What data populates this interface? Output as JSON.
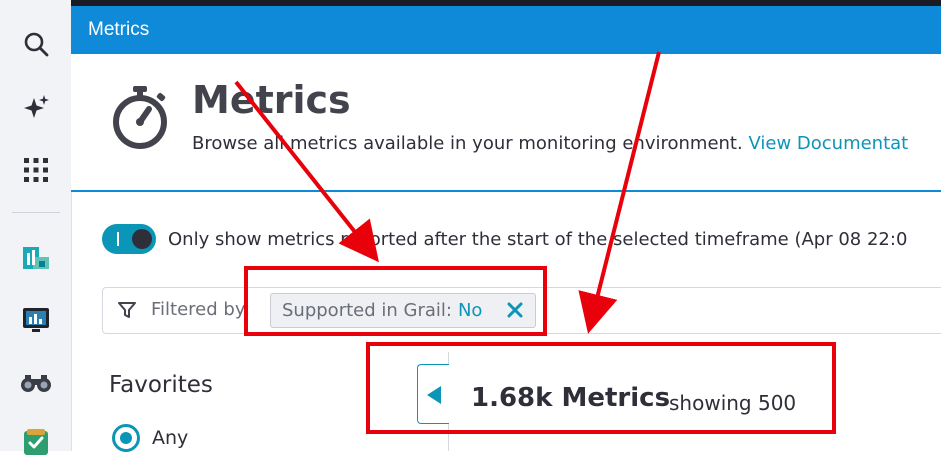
{
  "window": {
    "title": "Metrics"
  },
  "header": {
    "title": "Metrics",
    "subtitle": "Browse all metrics available in your monitoring environment.",
    "doc_link": "View Documentat"
  },
  "toggle": {
    "on": true,
    "label": "Only show metrics reported after the start of the selected timeframe (Apr 08 22:0"
  },
  "filter": {
    "label": "Filtered by:",
    "chip_key": "Supported in Grail:",
    "chip_value": "No"
  },
  "favorites": {
    "title": "Favorites",
    "option": "Any",
    "selected": true
  },
  "results": {
    "count": "1.68k Metrics",
    "showing": "showing 500"
  },
  "rail": {
    "icons": [
      "search-icon",
      "sparkle-icon",
      "apps-grid-icon",
      "dashboard-app-icon",
      "monitor-app-icon",
      "binoculars-icon",
      "checklist-app-icon"
    ]
  },
  "colors": {
    "brand_blue": "#0f8ad8",
    "accent_teal": "#0b95b6",
    "annotation_red": "#e8000b"
  }
}
